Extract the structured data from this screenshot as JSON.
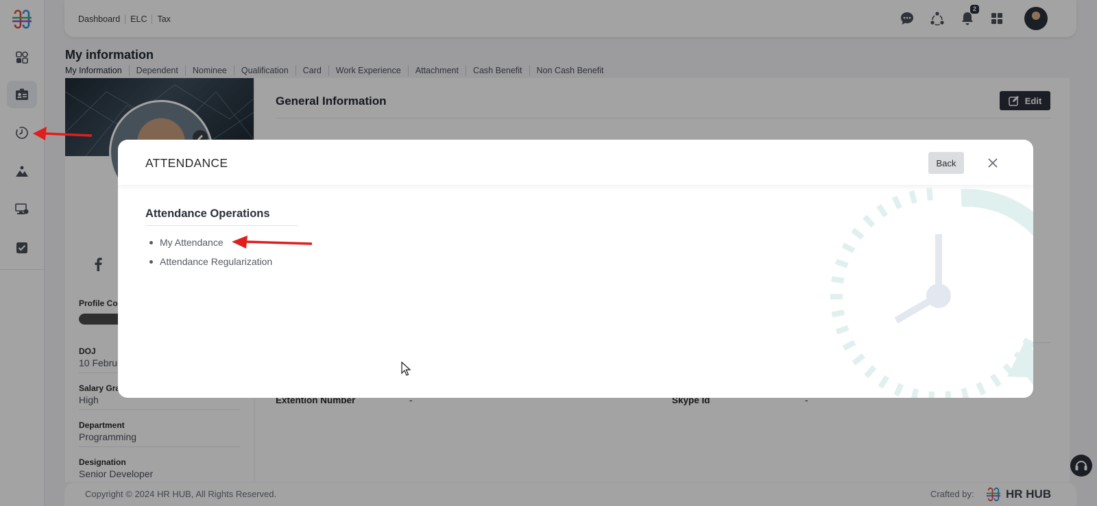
{
  "header": {
    "breadcrumbs": [
      "Dashboard",
      "ELC",
      "Tax"
    ],
    "notification_count": "2",
    "icons": [
      "chat-icon",
      "network-icon",
      "bell-icon",
      "apps-grid-icon"
    ]
  },
  "sidebar": {
    "icons": [
      "dashboard-icon",
      "id-card-icon",
      "attendance-clock-icon",
      "landscape-icon",
      "workstation-icon",
      "checkbox-icon"
    ]
  },
  "page": {
    "title": "My information",
    "tabs": [
      "My Information",
      "Dependent",
      "Nominee",
      "Qualification",
      "Card",
      "Work Experience",
      "Attachment",
      "Cash Benefit",
      "Non Cash Benefit"
    ]
  },
  "profile": {
    "completion_label": "Profile Co",
    "fields": [
      {
        "label": "DOJ",
        "value": "10 Febru"
      },
      {
        "label": "Salary Gra",
        "value": "High"
      },
      {
        "label": "Department",
        "value": "Programming"
      },
      {
        "label": "Designation",
        "value": "Senior Developer"
      }
    ]
  },
  "general": {
    "title": "General Information",
    "edit_label": "Edit",
    "field_left_label": "Extention Number",
    "field_left_value": "-",
    "field_right_label": "Skype Id",
    "field_right_value": "-"
  },
  "modal": {
    "title": "ATTENDANCE",
    "back_label": "Back",
    "section_title": "Attendance Operations",
    "items": [
      "My Attendance",
      "Attendance Regularization"
    ]
  },
  "footer": {
    "copyright": "Copyright © 2024 HR HUB, All Rights Reserved.",
    "crafted_by": "Crafted by:",
    "brand": "HR HUB"
  },
  "colors": {
    "accent_dark": "#2b2f3a",
    "annotation_arrow": "#e01e1e",
    "clock_teal": "#dff0ee",
    "clock_grey": "#e3e7f0"
  }
}
